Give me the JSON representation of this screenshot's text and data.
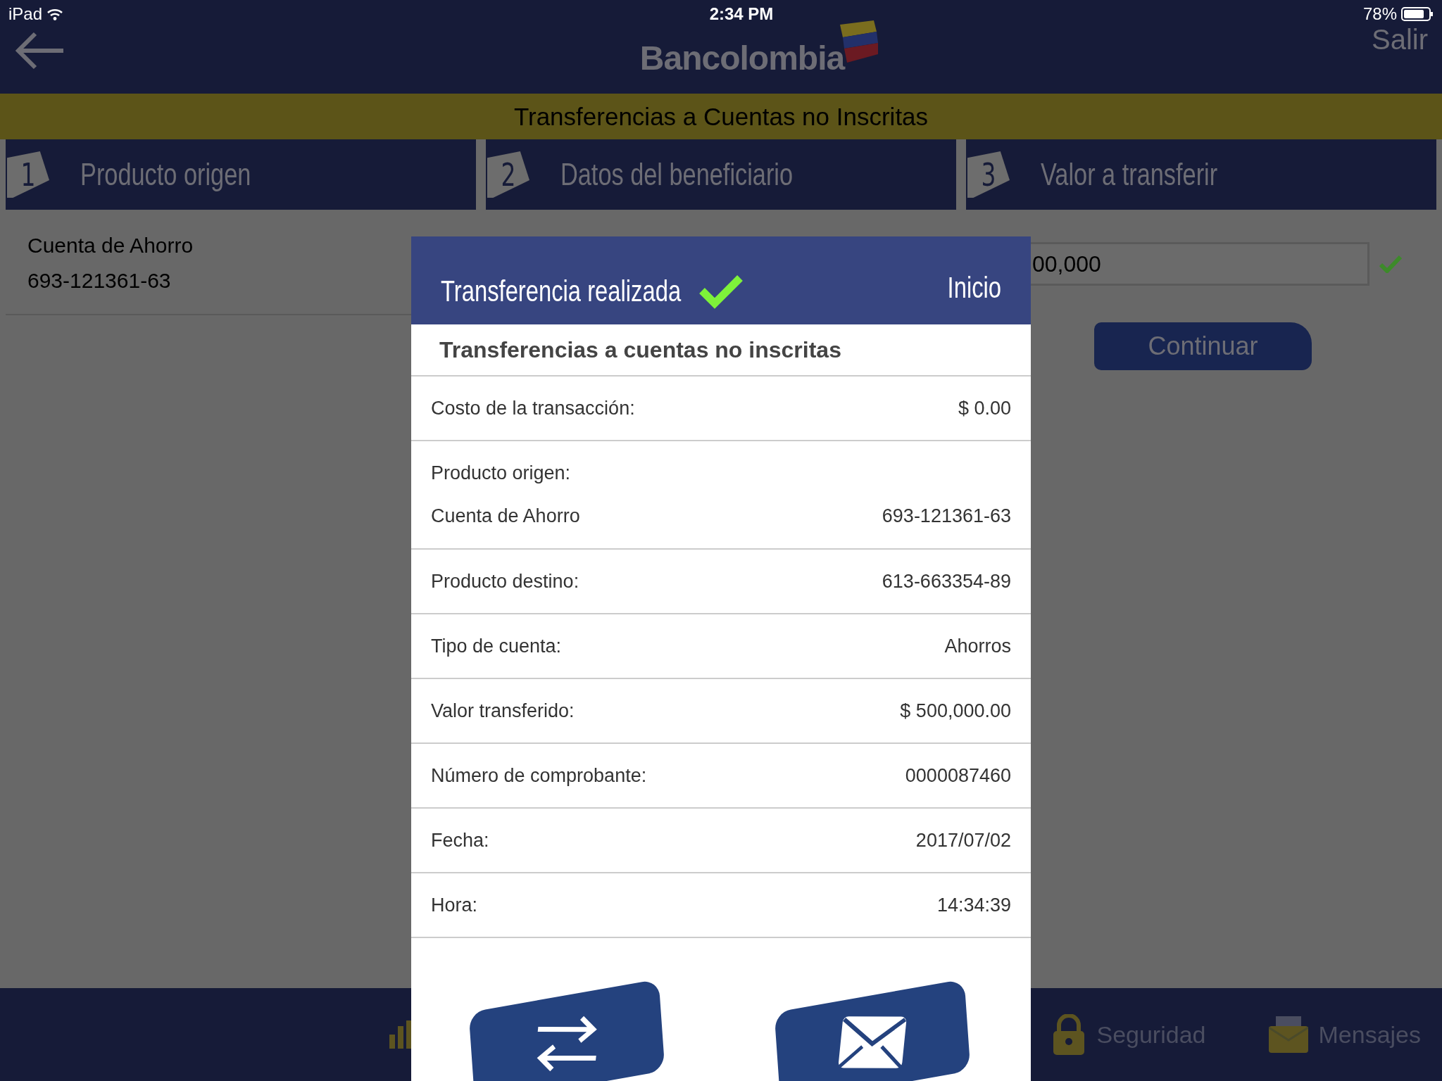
{
  "status_bar": {
    "device": "iPad",
    "time": "2:34 PM",
    "battery": "78%"
  },
  "header": {
    "logo": "Bancolombia",
    "logout": "Salir"
  },
  "banner": "Transferencias a Cuentas no Inscritas",
  "steps": [
    {
      "number": "1",
      "label": "Producto origen"
    },
    {
      "number": "2",
      "label": "Datos del beneficiario"
    },
    {
      "number": "3",
      "label": "Valor a transferir"
    }
  ],
  "origin_product": {
    "name": "Cuenta de Ahorro",
    "number": "693-121361-63"
  },
  "amount": {
    "value": "00,000",
    "valid": true
  },
  "continue_button": "Continuar",
  "bottom_tabs": [
    {
      "kind": "chart"
    },
    {
      "kind": "lock",
      "label": "Seguridad"
    },
    {
      "kind": "mail",
      "label": "Mensajes"
    }
  ],
  "modal": {
    "title": "Transferencia realizada",
    "success": true,
    "home_link": "Inicio",
    "subtitle": "Transferencias a cuentas no inscritas",
    "rows": [
      {
        "label": "Costo de la transacción:",
        "value": "$ 0.00"
      },
      {
        "label": "Producto origen:",
        "sub_label": "Cuenta de Ahorro",
        "value": "693-121361-63"
      },
      {
        "label": "Producto destino:",
        "value": "613-663354-89"
      },
      {
        "label": "Tipo de cuenta:",
        "value": "Ahorros"
      },
      {
        "label": "Valor transferido:",
        "value": "$ 500,000.00"
      },
      {
        "label": "Número de comprobante:",
        "value": "0000087460"
      },
      {
        "label": "Fecha:",
        "value": "2017/07/02"
      },
      {
        "label": "Hora:",
        "value": "14:34:39"
      }
    ],
    "actions": [
      {
        "kind": "transfer"
      },
      {
        "kind": "mail"
      }
    ]
  }
}
